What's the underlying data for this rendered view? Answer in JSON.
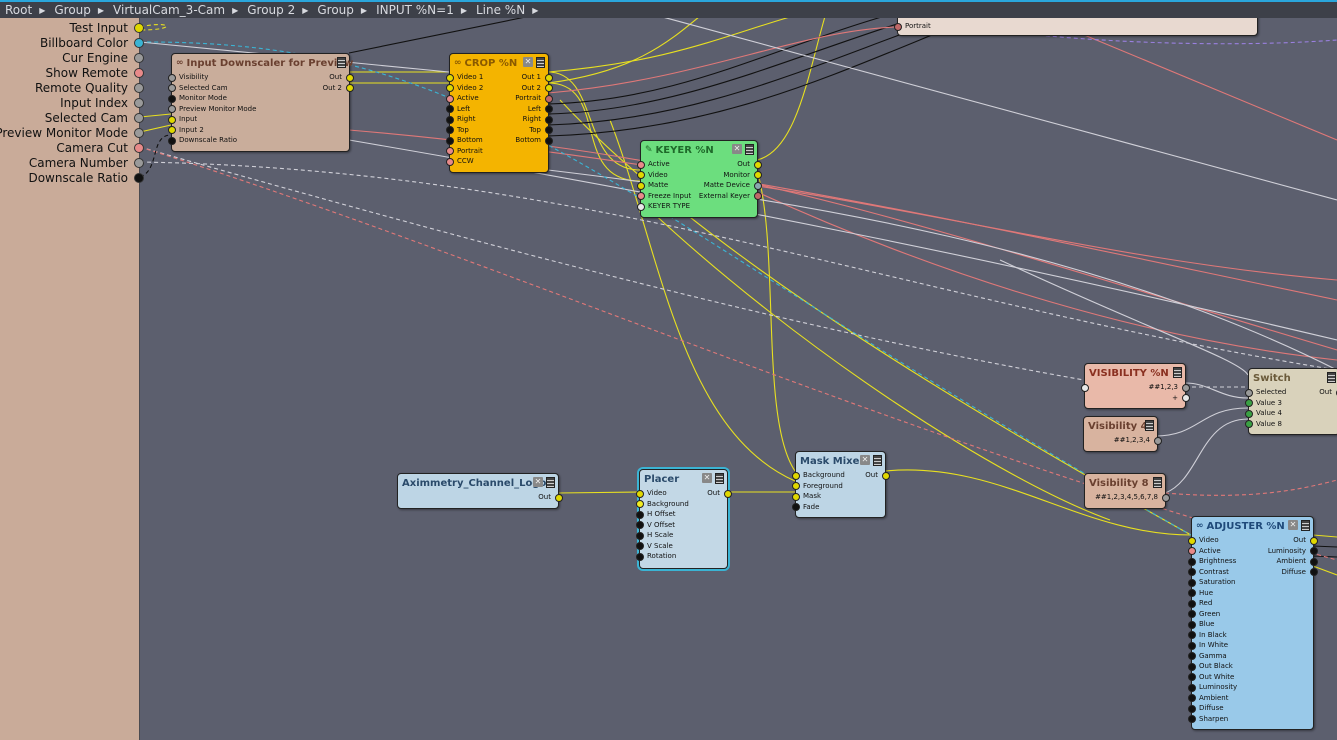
{
  "breadcrumb": [
    "Root",
    "Group",
    "VirtualCam_3-Cam",
    "Group 2",
    "Group",
    "INPUT %N=1",
    "Line %N"
  ],
  "port_colors": {
    "video": "#e0d800",
    "video_bright": "#f2ec20",
    "bool": "#e88a8a",
    "number": "#111111",
    "any": "#9a9a9a",
    "value": "#3aa044",
    "color": "#3bb4d4",
    "white": "#e8e8e8",
    "device": "#8aa8b0",
    "ext": "#c06868"
  },
  "left_panel": [
    {
      "label": "Test Input",
      "type": "video"
    },
    {
      "label": "Billboard Color",
      "type": "color"
    },
    {
      "label": "Cur Engine",
      "type": "any"
    },
    {
      "label": "Show Remote",
      "type": "bool"
    },
    {
      "label": "Remote Quality",
      "type": "any"
    },
    {
      "label": "Input Index",
      "type": "any"
    },
    {
      "label": "Selected Cam",
      "type": "any"
    },
    {
      "label": "Preview Monitor Mode",
      "type": "any"
    },
    {
      "label": "Camera Cut",
      "type": "bool"
    },
    {
      "label": "Camera Number",
      "type": "any"
    },
    {
      "label": "Downscale Ratio",
      "type": "number"
    }
  ],
  "nodes": {
    "downscaler": {
      "title": "Input Downscaler for Preview",
      "icon": "link",
      "bg": "#c9ad9b",
      "tc": "#6a4030",
      "close": false,
      "inputs": [
        [
          "Visibility",
          "any"
        ],
        [
          "Selected Cam",
          "any"
        ],
        [
          "Monitor Mode",
          "number"
        ],
        [
          "Preview Monitor Mode",
          "any"
        ],
        [
          "Input",
          "video"
        ],
        [
          "Input 2",
          "video"
        ],
        [
          "Downscale Ratio",
          "number"
        ]
      ],
      "outputs": [
        [
          "Out",
          "video"
        ],
        [
          "Out 2",
          "video"
        ]
      ]
    },
    "crop": {
      "title": "CROP %N",
      "icon": "link",
      "bg": "#f4b400",
      "tc": "#8a5a00",
      "close": true,
      "inputs": [
        [
          "Video 1",
          "video"
        ],
        [
          "Video 2",
          "video"
        ],
        [
          "Active",
          "bool"
        ],
        [
          "Left",
          "number"
        ],
        [
          "Right",
          "number"
        ],
        [
          "Top",
          "number"
        ],
        [
          "Bottom",
          "number"
        ],
        [
          "Portrait",
          "bool"
        ],
        [
          "CCW",
          "bool"
        ]
      ],
      "outputs": [
        [
          "Out 1",
          "video"
        ],
        [
          "Out 2",
          "video"
        ],
        [
          "Portrait",
          "ext"
        ],
        [
          "Left",
          "number"
        ],
        [
          "Right",
          "number"
        ],
        [
          "Top",
          "number"
        ],
        [
          "Bottom",
          "number"
        ]
      ]
    },
    "keyer": {
      "title": "KEYER %N",
      "icon": "edit",
      "bg": "#6cde7e",
      "tc": "#1f6a2a",
      "close": true,
      "inputs": [
        [
          "Active",
          "bool"
        ],
        [
          "Video",
          "video"
        ],
        [
          "Matte",
          "video"
        ],
        [
          "Freeze Input",
          "bool"
        ],
        [
          "KEYER TYPE",
          "white"
        ]
      ],
      "outputs": [
        [
          "Out",
          "video"
        ],
        [
          "Monitor",
          "video"
        ],
        [
          "Matte Device",
          "device"
        ],
        [
          "External Keyer",
          "ext"
        ]
      ]
    },
    "topnode": {
      "title": "",
      "icon": "",
      "bg": "#e8d9d0",
      "tc": "#333",
      "close": false,
      "nomenu": true,
      "inputs": [
        [
          "Portrait",
          "ext"
        ]
      ],
      "outputs": []
    },
    "visibility": {
      "title": "VISIBILITY %N",
      "icon": "",
      "bg": "#e9b9a9",
      "tc": "#8a3020",
      "close": false,
      "inputs": [
        [
          "",
          "white"
        ]
      ],
      "outputs": [
        [
          "##1,2,3",
          "any"
        ],
        [
          "+",
          "white"
        ]
      ]
    },
    "vis4": {
      "title": "Visibility 4",
      "icon": "",
      "bg": "#d8b39f",
      "tc": "#6a4030",
      "close": false,
      "inputs": [],
      "outputs": [
        [
          "##1,2,3,4",
          "any"
        ]
      ]
    },
    "vis8": {
      "title": "Visibility 8",
      "icon": "",
      "bg": "#d8b39f",
      "tc": "#6a4030",
      "close": false,
      "inputs": [],
      "outputs": [
        [
          "##1,2,3,4,5,6,7,8",
          "any"
        ]
      ]
    },
    "switch": {
      "title": "Switch",
      "icon": "",
      "bg": "#d9d2bb",
      "tc": "#6a5a3a",
      "close": false,
      "inputs": [
        [
          "Selected",
          "any"
        ],
        [
          "Value 3",
          "value"
        ],
        [
          "Value 4",
          "value"
        ],
        [
          "Value 8",
          "value"
        ]
      ],
      "outputs": [
        [
          "Out",
          "value"
        ]
      ]
    },
    "adjuster": {
      "title": "ADJUSTER %N",
      "icon": "link",
      "bg": "#99c9e9",
      "tc": "#1f4a7a",
      "close": true,
      "inputs": [
        [
          "Video",
          "video"
        ],
        [
          "Active",
          "bool"
        ],
        [
          "Brightness",
          "number"
        ],
        [
          "Contrast",
          "number"
        ],
        [
          "Saturation",
          "number"
        ],
        [
          "Hue",
          "number"
        ],
        [
          "Red",
          "number"
        ],
        [
          "Green",
          "number"
        ],
        [
          "Blue",
          "number"
        ],
        [
          "In Black",
          "number"
        ],
        [
          "In White",
          "number"
        ],
        [
          "Gamma",
          "number"
        ],
        [
          "Out Black",
          "number"
        ],
        [
          "Out White",
          "number"
        ],
        [
          "Luminosity",
          "number"
        ],
        [
          "Ambient",
          "number"
        ],
        [
          "Diffuse",
          "number"
        ],
        [
          "Sharpen",
          "number"
        ]
      ],
      "outputs": [
        [
          "Out",
          "video"
        ],
        [
          "Luminosity",
          "number"
        ],
        [
          "Ambient",
          "number"
        ],
        [
          "Diffuse",
          "number"
        ]
      ]
    },
    "logo": {
      "title": "Aximmetry_Channel_Logo",
      "icon": "",
      "bg": "#bdd5e5",
      "tc": "#2a4a6a",
      "close": true,
      "inputs": [],
      "outputs": [
        [
          "Out",
          "video"
        ]
      ]
    },
    "placer": {
      "title": "Placer",
      "icon": "",
      "bg": "#c3d8e6",
      "tc": "#2a4a6a",
      "close": true,
      "inputs": [
        [
          "Video",
          "video"
        ],
        [
          "Background",
          "video_bright"
        ],
        [
          "H Offset",
          "number"
        ],
        [
          "V Offset",
          "number"
        ],
        [
          "H Scale",
          "number"
        ],
        [
          "V Scale",
          "number"
        ],
        [
          "Rotation",
          "number"
        ]
      ],
      "outputs": [
        [
          "Out",
          "video"
        ]
      ]
    },
    "maskmixer": {
      "title": "Mask Mixer",
      "icon": "",
      "bg": "#bdd5e5",
      "tc": "#2a4a6a",
      "close": true,
      "inputs": [
        [
          "Background",
          "video"
        ],
        [
          "Foreground",
          "video"
        ],
        [
          "Mask",
          "video"
        ],
        [
          "Fade",
          "number"
        ]
      ],
      "outputs": [
        [
          "Out",
          "video"
        ]
      ]
    }
  }
}
